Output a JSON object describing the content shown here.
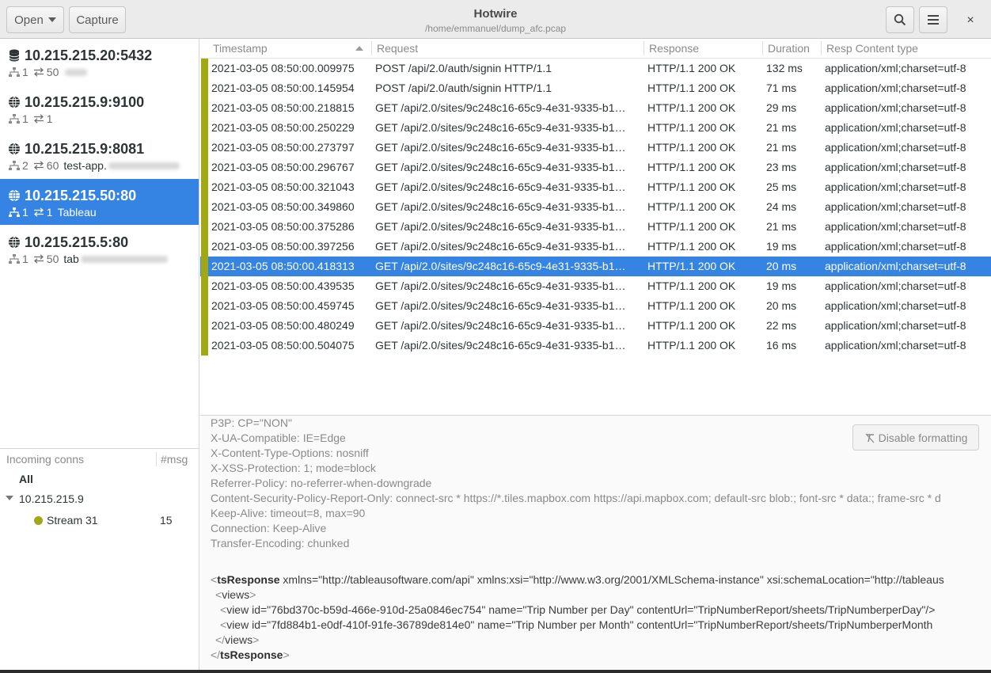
{
  "window": {
    "title": "Hotwire",
    "subtitle": "/home/emmanuel/dump_afc.pcap",
    "open_label": "Open",
    "capture_label": "Capture",
    "close_glyph": "×"
  },
  "servers": [
    {
      "name": "10.215.215.20:5432",
      "icon": "database-icon",
      "remotes": "1",
      "messages": "50",
      "label": ""
    },
    {
      "name": "10.215.215.9:9100",
      "icon": "globe-icon",
      "remotes": "1",
      "messages": "1",
      "label": ""
    },
    {
      "name": "10.215.215.9:8081",
      "icon": "globe-icon",
      "remotes": "2",
      "messages": "60",
      "label": "test-app."
    },
    {
      "name": "10.215.215.50:80",
      "icon": "globe-icon",
      "remotes": "1",
      "messages": "1",
      "label": "Tableau"
    },
    {
      "name": "10.215.215.5:80",
      "icon": "globe-icon",
      "remotes": "1",
      "messages": "50",
      "label": "tab"
    }
  ],
  "incoming": {
    "header_conns": "Incoming conns",
    "header_msg": "#msg",
    "all_label": "All",
    "ip": "10.215.215.9",
    "stream_label": "Stream 31",
    "stream_count": "15"
  },
  "table": {
    "headers": [
      "Timestamp",
      "Request",
      "Response",
      "Duration",
      "Resp Content type"
    ],
    "rows": [
      [
        "2021-03-05 08:50:00.009975",
        "POST /api/2.0/auth/signin HTTP/1.1",
        "HTTP/1.1 200 OK",
        "132 ms",
        "application/xml;charset=utf-8"
      ],
      [
        "2021-03-05 08:50:00.145954",
        "POST /api/2.0/auth/signin HTTP/1.1",
        "HTTP/1.1 200 OK",
        "71 ms",
        "application/xml;charset=utf-8"
      ],
      [
        "2021-03-05 08:50:00.218815",
        "GET /api/2.0/sites/9c248c16-65c9-4e31-9335-b1…",
        "HTTP/1.1 200 OK",
        "29 ms",
        "application/xml;charset=utf-8"
      ],
      [
        "2021-03-05 08:50:00.250229",
        "GET /api/2.0/sites/9c248c16-65c9-4e31-9335-b1…",
        "HTTP/1.1 200 OK",
        "21 ms",
        "application/xml;charset=utf-8"
      ],
      [
        "2021-03-05 08:50:00.273797",
        "GET /api/2.0/sites/9c248c16-65c9-4e31-9335-b1…",
        "HTTP/1.1 200 OK",
        "21 ms",
        "application/xml;charset=utf-8"
      ],
      [
        "2021-03-05 08:50:00.296767",
        "GET /api/2.0/sites/9c248c16-65c9-4e31-9335-b1…",
        "HTTP/1.1 200 OK",
        "23 ms",
        "application/xml;charset=utf-8"
      ],
      [
        "2021-03-05 08:50:00.321043",
        "GET /api/2.0/sites/9c248c16-65c9-4e31-9335-b1…",
        "HTTP/1.1 200 OK",
        "25 ms",
        "application/xml;charset=utf-8"
      ],
      [
        "2021-03-05 08:50:00.349860",
        "GET /api/2.0/sites/9c248c16-65c9-4e31-9335-b1…",
        "HTTP/1.1 200 OK",
        "24 ms",
        "application/xml;charset=utf-8"
      ],
      [
        "2021-03-05 08:50:00.375286",
        "GET /api/2.0/sites/9c248c16-65c9-4e31-9335-b1…",
        "HTTP/1.1 200 OK",
        "21 ms",
        "application/xml;charset=utf-8"
      ],
      [
        "2021-03-05 08:50:00.397256",
        "GET /api/2.0/sites/9c248c16-65c9-4e31-9335-b1…",
        "HTTP/1.1 200 OK",
        "19 ms",
        "application/xml;charset=utf-8"
      ],
      [
        "2021-03-05 08:50:00.418313",
        "GET /api/2.0/sites/9c248c16-65c9-4e31-9335-b1…",
        "HTTP/1.1 200 OK",
        "20 ms",
        "application/xml;charset=utf-8"
      ],
      [
        "2021-03-05 08:50:00.439535",
        "GET /api/2.0/sites/9c248c16-65c9-4e31-9335-b1…",
        "HTTP/1.1 200 OK",
        "19 ms",
        "application/xml;charset=utf-8"
      ],
      [
        "2021-03-05 08:50:00.459745",
        "GET /api/2.0/sites/9c248c16-65c9-4e31-9335-b1…",
        "HTTP/1.1 200 OK",
        "20 ms",
        "application/xml;charset=utf-8"
      ],
      [
        "2021-03-05 08:50:00.480249",
        "GET /api/2.0/sites/9c248c16-65c9-4e31-9335-b1…",
        "HTTP/1.1 200 OK",
        "22 ms",
        "application/xml;charset=utf-8"
      ],
      [
        "2021-03-05 08:50:00.504075",
        "GET /api/2.0/sites/9c248c16-65c9-4e31-9335-b1…",
        "HTTP/1.1 200 OK",
        "16 ms",
        "application/xml;charset=utf-8"
      ]
    ]
  },
  "detail": {
    "disable_formatting_label": "Disable formatting",
    "headers": [
      "P3P: CP=\"NON\"",
      "X-UA-Compatible: IE=Edge",
      "X-Content-Type-Options: nosniff",
      "X-XSS-Protection: 1; mode=block",
      "Referrer-Policy: no-referrer-when-downgrade",
      "Content-Security-Policy-Report-Only: connect-src * https://*.tiles.mapbox.com https://api.mapbox.com; default-src blob:; font-src * data:; frame-src * d",
      "Keep-Alive: timeout=8, max=90",
      "Connection: Keep-Alive",
      "Transfer-Encoding: chunked"
    ],
    "xml": {
      "ts_open_tag": "tsResponse",
      "ts_open_attrs": " xmlns=\"http://tableausoftware.com/api\" xmlns:xsi=\"http://www.w3.org/2001/XMLSchema-instance\" xsi:schemaLocation=\"http://tableaus",
      "views_open": "views",
      "view_tag": "view",
      "view1_attrs": " id=\"76bd370c-b59d-466e-910d-25a0846ec754\" name=\"Trip Number per Day\" contentUrl=\"TripNumberReport/sheets/TripNumberperDay\"/>",
      "view2_attrs": " id=\"7fd884b1-e0df-410f-91fe-36789de814e0\" name=\"Trip Number per Month\" contentUrl=\"TripNumberReport/sheets/TripNumberperMonth",
      "views_close": "views",
      "ts_close_tag": "tsResponse"
    }
  },
  "colors": {
    "accent": "#3584e4",
    "stream_marker": "#a0a816"
  }
}
